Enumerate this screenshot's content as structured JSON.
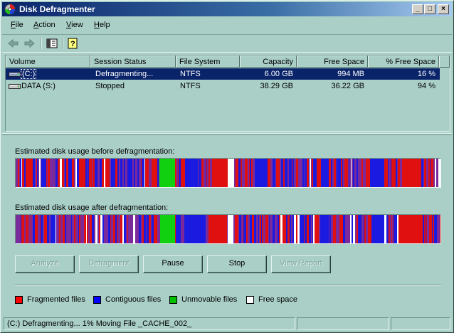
{
  "window": {
    "title": "Disk Defragmenter"
  },
  "title_buttons": {
    "minimize": "_",
    "maximize": "□",
    "close": "×"
  },
  "menu": [
    {
      "label": "File",
      "key": "F",
      "rest": "ile"
    },
    {
      "label": "Action",
      "key": "A",
      "rest": "ction"
    },
    {
      "label": "View",
      "key": "V",
      "rest": "iew"
    },
    {
      "label": "Help",
      "key": "H",
      "rest": "elp"
    }
  ],
  "toolbar": {
    "icons": [
      "back-arrow-icon",
      "forward-arrow-icon",
      "show-hide-console-tree-icon",
      "help-icon"
    ]
  },
  "volumes": {
    "columns": [
      "Volume",
      "Session Status",
      "File System",
      "Capacity",
      "Free Space",
      "% Free Space"
    ],
    "rows": [
      {
        "volume": "(C:)",
        "status": "Defragmenting...",
        "fs": "NTFS",
        "capacity": "6.00 GB",
        "free": "994 MB",
        "pct": "16 %",
        "selected": true
      },
      {
        "volume": "DATA (S:)",
        "status": "Stopped",
        "fs": "NTFS",
        "capacity": "38.29 GB",
        "free": "36.22 GB",
        "pct": "94 %",
        "selected": false
      }
    ]
  },
  "analysis": {
    "before_label": "Estimated disk usage before defragmentation:",
    "after_label": "Estimated disk usage after defragmentation:"
  },
  "buttons": {
    "analyze": "Analyze",
    "defragment": "Defragment",
    "pause": "Pause",
    "stop": "Stop",
    "view_report": "View Report"
  },
  "legend": [
    {
      "label": "Fragmented files",
      "color": "#ff0000"
    },
    {
      "label": "Contiguous files",
      "color": "#0000ff"
    },
    {
      "label": "Unmovable files",
      "color": "#00c000"
    },
    {
      "label": "Free space",
      "color": "#ffffff"
    }
  ],
  "colors": {
    "fragmented": "#e01010",
    "contiguous": "#1a1ae0",
    "unmovable": "#10d010",
    "free": "#ffffff",
    "system_purple": "#7a2a9a"
  },
  "status": {
    "message": "(C:) Defragmenting... 1%  Moving File _CACHE_002_",
    "pane2": "",
    "pane3": ""
  }
}
